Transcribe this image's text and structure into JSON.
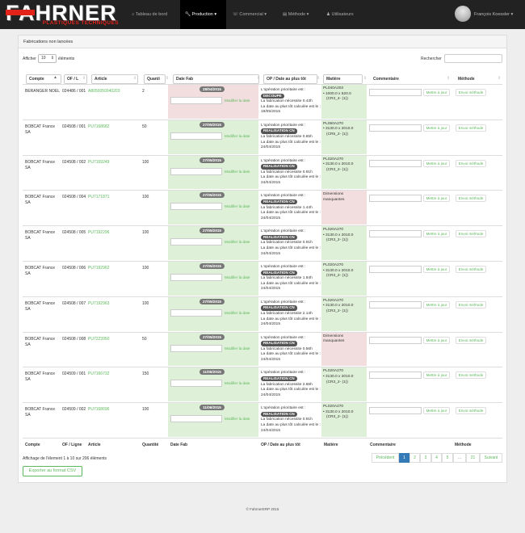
{
  "nav": {
    "logo_big": "FAHRNER",
    "logo_small": "PLASTIQUES TECHNIQUES",
    "items": [
      {
        "label": "Tableau de bord",
        "icon": "home-icon"
      },
      {
        "label": "Production",
        "icon": "wrench-icon"
      },
      {
        "label": "Commercial",
        "icon": "phone-icon"
      },
      {
        "label": "Méthode",
        "icon": "book-icon"
      },
      {
        "label": "Utilisateurs",
        "icon": "user-icon"
      }
    ],
    "user": "François Koessler"
  },
  "panel": {
    "title": "Fabrications non lancées"
  },
  "length": {
    "prefix": "Afficher",
    "value": "10",
    "suffix": "éléments"
  },
  "search": {
    "label": "Rechercher",
    "value": ""
  },
  "columns": [
    "Compte",
    "OF / L",
    "Article",
    "Quanti",
    "Date Fab",
    "OP / Date au plus tôt",
    "Matière",
    "Commentaire",
    "Méthode"
  ],
  "footer_columns": [
    "Compte",
    "OF / Ligne",
    "Article",
    "Quantité",
    "Date Fab",
    "OP / Date au plus tôt",
    "Matière",
    "Commentaire",
    "Méthode"
  ],
  "labels": {
    "modify_date": "Modifier la date",
    "op_prefix": "L'opération prioritaire est :",
    "op_need": "La fabrication nécessite",
    "date_calc": "La date au plus tôt calculée est le :",
    "save": "Mettre à jour",
    "send": "Envoi méthode"
  },
  "colors": {
    "red_cell": "#f2dede",
    "green_cell": "#dff0d8",
    "accent": "#5cb85c",
    "nav": "#222222"
  },
  "rows": [
    {
      "compte": "BERANGER NOEL",
      "of": "024486 / 001",
      "article": "A8050050040203",
      "qty": "2",
      "date": "28/04/2015",
      "date_status": "red",
      "op": "DECOUPE",
      "hours": "0.43h",
      "earliest": "19/05/2015",
      "mat_status": "green",
      "mat_code": "PL040A203",
      "mat_dims": "1000.0 x 520.0",
      "mat_note": "(CR3_4- (1))"
    },
    {
      "compte": "BOBCAT France SA",
      "of": "024508 / 001",
      "article": "PU7168682",
      "qty": "50",
      "date": "27/05/2015",
      "date_status": "green",
      "op": "REALISATION CN",
      "hours": "0.65h",
      "earliest": "24/04/2015",
      "mat_status": "green",
      "mat_code": "PL050A270",
      "mat_dims": "3130.0 x 2010.0",
      "mat_note": "(CR5_2- (1))"
    },
    {
      "compte": "BOBCAT France SA",
      "of": "024508 / 002",
      "article": "PU7169249",
      "qty": "100",
      "date": "27/05/2015",
      "date_status": "green",
      "op": "REALISATION CN",
      "hours": "0.91h",
      "earliest": "24/04/2015",
      "mat_status": "green",
      "mat_code": "PL020A270",
      "mat_dims": "3130.0 x 2010.0",
      "mat_note": "(CR3_2- (1))"
    },
    {
      "compte": "BOBCAT France SA",
      "of": "024508 / 004",
      "article": "PU7171871",
      "qty": "100",
      "date": "27/05/2015",
      "date_status": "green",
      "op": "REALISATION CN",
      "hours": "1.44h",
      "earliest": "24/04/2015",
      "mat_status": "red",
      "mat_code": "Dimensions manquantes",
      "mat_dims": "",
      "mat_note": ""
    },
    {
      "compte": "BOBCAT France SA",
      "of": "024508 / 005",
      "article": "PU7192296",
      "qty": "100",
      "date": "27/05/2015",
      "date_status": "green",
      "op": "REALISATION CN",
      "hours": "0.91h",
      "earliest": "24/04/2015",
      "mat_status": "green",
      "mat_code": "PL020A270",
      "mat_dims": "3130.0 x 2010.0",
      "mat_note": "(CR3_2- (1))"
    },
    {
      "compte": "BOBCAT France SA",
      "of": "024508 / 006",
      "article": "PU7192962",
      "qty": "100",
      "date": "27/05/2015",
      "date_status": "green",
      "op": "REALISATION CN",
      "hours": "1.84h",
      "earliest": "24/04/2015",
      "mat_status": "green",
      "mat_code": "PL020A270",
      "mat_dims": "3130.0 x 2010.0",
      "mat_note": "(CR3_2- (1))"
    },
    {
      "compte": "BOBCAT France SA",
      "of": "024508 / 007",
      "article": "PU7192963",
      "qty": "100",
      "date": "27/05/2015",
      "date_status": "green",
      "op": "REALISATION CN",
      "hours": "2.14h",
      "earliest": "24/04/2015",
      "mat_status": "green",
      "mat_code": "PL020A270",
      "mat_dims": "3130.0 x 2010.0",
      "mat_note": "(CR3_2- (1))"
    },
    {
      "compte": "BOBCAT France SA",
      "of": "024508 / 008",
      "article": "PU7223950",
      "qty": "50",
      "date": "27/05/2015",
      "date_status": "green",
      "op": "REALISATION CN",
      "hours": "0.56h",
      "earliest": "24/04/2015",
      "mat_status": "red",
      "mat_code": "Dimensions manquantes",
      "mat_dims": "",
      "mat_note": ""
    },
    {
      "compte": "BOBCAT France SA",
      "of": "024509 / 001",
      "article": "PU7166732",
      "qty": "150",
      "date": "11/06/2015",
      "date_status": "green",
      "op": "REALISATION CN",
      "hours": "2.66h",
      "earliest": "24/04/2015",
      "mat_status": "green",
      "mat_code": "PL020A270",
      "mat_dims": "3130.0 x 2010.0",
      "mat_note": "(CR3_2- (1))"
    },
    {
      "compte": "BOBCAT France SA",
      "of": "024509 / 002",
      "article": "PU7168696",
      "qty": "100",
      "date": "11/06/2015",
      "date_status": "green",
      "op": "REALISATION CN",
      "hours": "0.91h",
      "earliest": "24/04/2015",
      "mat_status": "green",
      "mat_code": "PL020A270",
      "mat_dims": "3130.0 x 2010.0",
      "mat_note": "(CR3_2- (1))"
    }
  ],
  "info": "Affichage de l'élement 1 à 10 sur 206 éléments",
  "pagination": [
    "Précédent",
    "1",
    "2",
    "3",
    "4",
    "5",
    "…",
    "21",
    "Suivant"
  ],
  "csv_button": "Exporter au format CSV",
  "footer": "© FahrnerERP 2015"
}
